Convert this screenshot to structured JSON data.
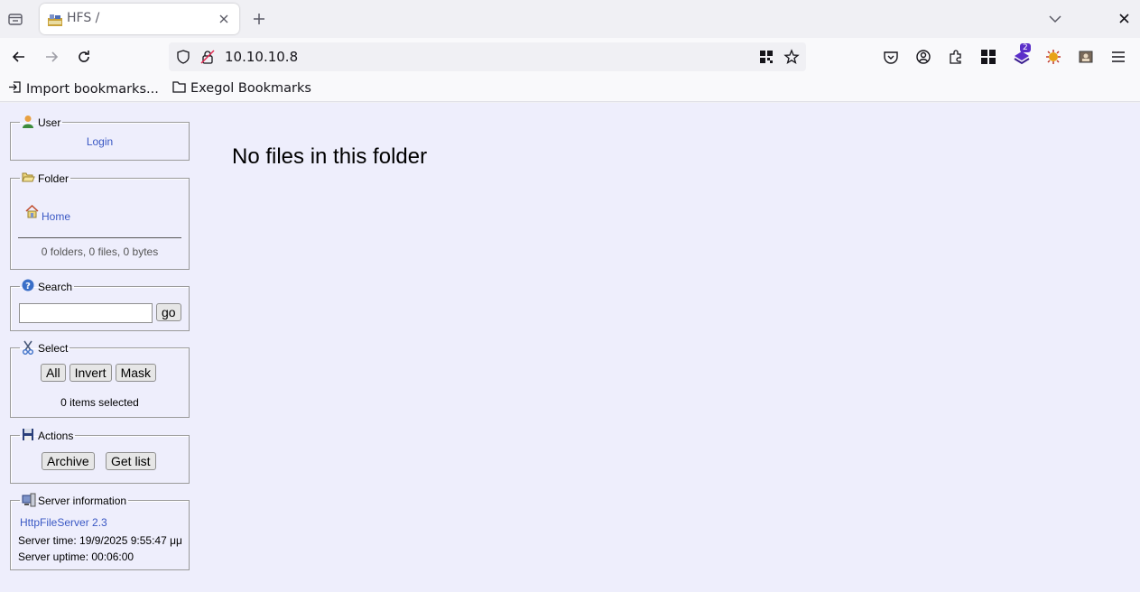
{
  "browser": {
    "tab_title": "HFS /",
    "url": "10.10.10.8",
    "extension_badge": "2",
    "bookmarks": {
      "import_label": "Import bookmarks...",
      "folder_label": "Exegol Bookmarks"
    }
  },
  "sidebar": {
    "user": {
      "legend": "User",
      "login_link": "Login"
    },
    "folder": {
      "legend": "Folder",
      "home_link": "Home",
      "summary": "0 folders, 0 files, 0 bytes"
    },
    "search": {
      "legend": "Search",
      "go_label": "go"
    },
    "select": {
      "legend": "Select",
      "all_label": "All",
      "invert_label": "Invert",
      "mask_label": "Mask",
      "status": "0 items selected"
    },
    "actions": {
      "legend": "Actions",
      "archive_label": "Archive",
      "getlist_label": "Get list"
    },
    "server_info": {
      "legend": "Server information",
      "version_link": "HttpFileServer 2.3",
      "server_time": "Server time: 19/9/2025 9:55:47 μμ",
      "server_uptime": "Server uptime: 00:06:00"
    }
  },
  "main": {
    "message": "No files in this folder"
  },
  "colors": {
    "page_bg": "#eeeefc",
    "link": "#3a58c4",
    "badge": "#5b2fc9"
  }
}
